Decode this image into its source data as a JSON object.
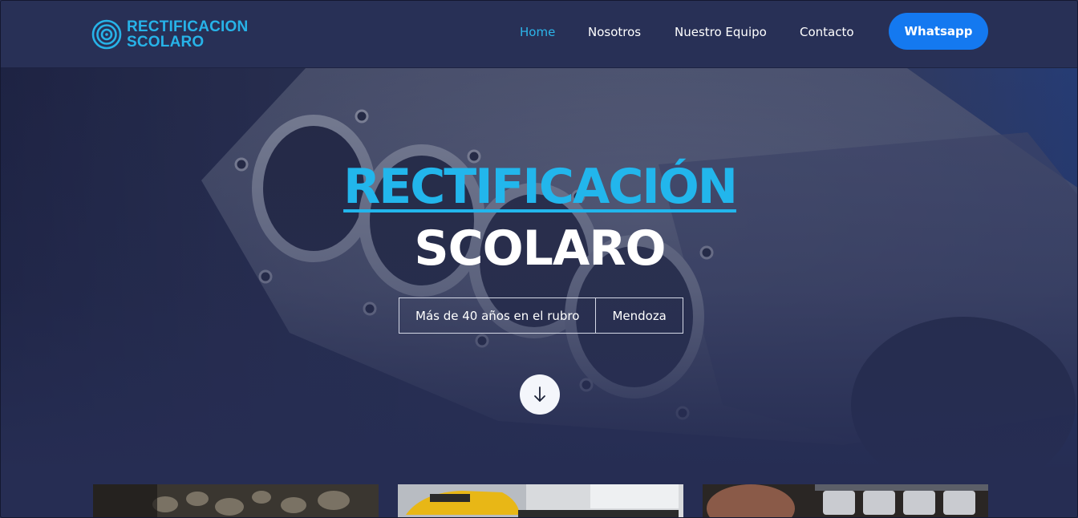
{
  "brand": {
    "line1": "RECTIFICACION",
    "line2": "SCOLARO",
    "icon": "concentric-circles-logo-icon",
    "color": "#27b3e8"
  },
  "nav": {
    "items": [
      {
        "label": "Home",
        "active": true
      },
      {
        "label": "Nosotros",
        "active": false
      },
      {
        "label": "Nuestro Equipo",
        "active": false
      },
      {
        "label": "Contacto",
        "active": false
      }
    ],
    "cta_label": "Whatsapp"
  },
  "hero": {
    "title_line1": "RECTIFICACIÓN",
    "title_line2": "SCOLARO",
    "tags": [
      "Más de 40 años en el rubro",
      "Mendoza"
    ],
    "scroll_icon": "arrow-down-icon",
    "background": "engine-block-photo"
  },
  "cards": [
    {
      "image": "engine-parts-photo"
    },
    {
      "image": "yellow-sports-car-photo"
    },
    {
      "image": "engine-heads-photo"
    }
  ],
  "colors": {
    "navbar": "#283056",
    "accent": "#22b6ec",
    "cta": "#1479f0",
    "page": "#262d53"
  }
}
